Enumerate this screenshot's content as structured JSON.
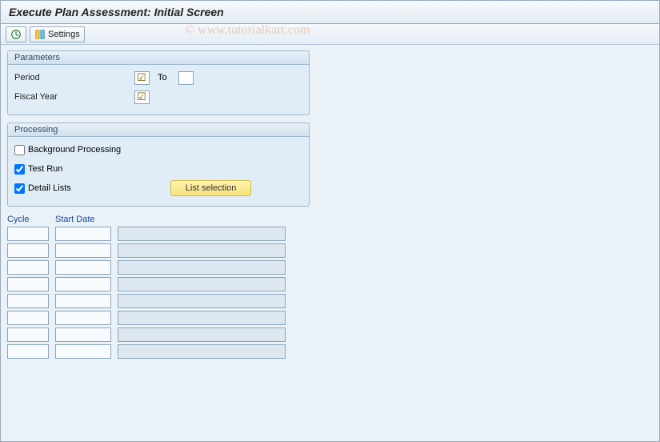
{
  "title": "Execute Plan Assessment: Initial Screen",
  "toolbar": {
    "execute_label": "",
    "settings_label": "Settings"
  },
  "parameters": {
    "header": "Parameters",
    "period_label": "Period",
    "to_label": "To",
    "fiscal_year_label": "Fiscal Year"
  },
  "processing": {
    "header": "Processing",
    "background_label": "Background Processing",
    "background_checked": false,
    "test_run_label": "Test Run",
    "test_run_checked": true,
    "detail_lists_label": "Detail Lists",
    "detail_lists_checked": true,
    "list_selection_label": "List selection"
  },
  "table": {
    "cycle_header": "Cycle",
    "start_date_header": "Start Date",
    "row_count": 8
  },
  "watermark": "© www.tutorialkart.com"
}
